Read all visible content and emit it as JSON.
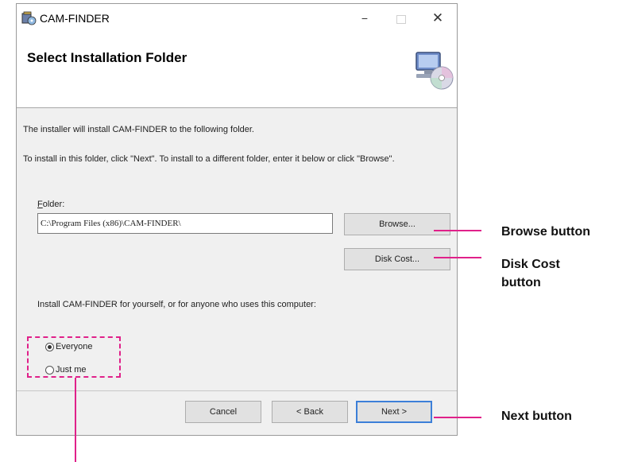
{
  "window": {
    "title": "CAM-FINDER",
    "minimize_glyph": "−",
    "close_glyph": "✕",
    "header_title": "Select Installation Folder"
  },
  "content": {
    "intro_line1": "The installer will install CAM-FINDER to the following folder.",
    "intro_line2": "To install in this folder, click \"Next\". To install to a different folder, enter it below or click \"Browse\".",
    "folder_label_prefix": "F",
    "folder_label_rest": "older:",
    "folder_value": "C:\\Program Files (x86)\\CAM-FINDER\\",
    "browse_label": "Browse...",
    "disk_cost_label": "Disk Cost...",
    "users_text": "Install CAM-FINDER for yourself, or for anyone who uses this computer:",
    "radio_everyone": "Everyone",
    "radio_justme": "Just me",
    "selected_option": "Everyone"
  },
  "footer": {
    "cancel_label": "Cancel",
    "back_label": "< Back",
    "next_label": "Next >"
  },
  "callouts": {
    "browse": "Browse button",
    "disk_cost_line1": "Disk Cost",
    "disk_cost_line2": "button",
    "next": "Next button"
  },
  "colors": {
    "callout": "#e0218a",
    "next_focus_border": "#3c7fd8"
  }
}
